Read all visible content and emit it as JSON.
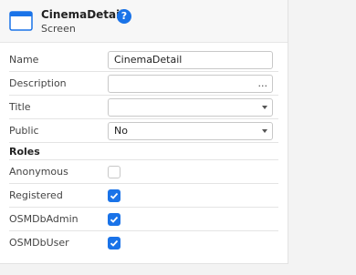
{
  "header": {
    "title": "CinemaDetail",
    "subtitle": "Screen",
    "help_icon": "question-icon",
    "screen_icon": "screen-window-icon",
    "help_glyph": "?"
  },
  "properties": {
    "name": {
      "label": "Name",
      "value": "CinemaDetail"
    },
    "description": {
      "label": "Description",
      "value": "",
      "button_glyph": "..."
    },
    "title": {
      "label": "Title",
      "value": ""
    },
    "public": {
      "label": "Public",
      "value": "No"
    }
  },
  "roles": {
    "heading": "Roles",
    "items": [
      {
        "label": "Anonymous",
        "checked": false
      },
      {
        "label": "Registered",
        "checked": true
      },
      {
        "label": "OSMDbAdmin",
        "checked": true
      },
      {
        "label": "OSMDbUser",
        "checked": true
      }
    ]
  },
  "colors": {
    "accent": "#1a73e8",
    "border": "#c8c8c8",
    "background": "#f3f3f3"
  }
}
